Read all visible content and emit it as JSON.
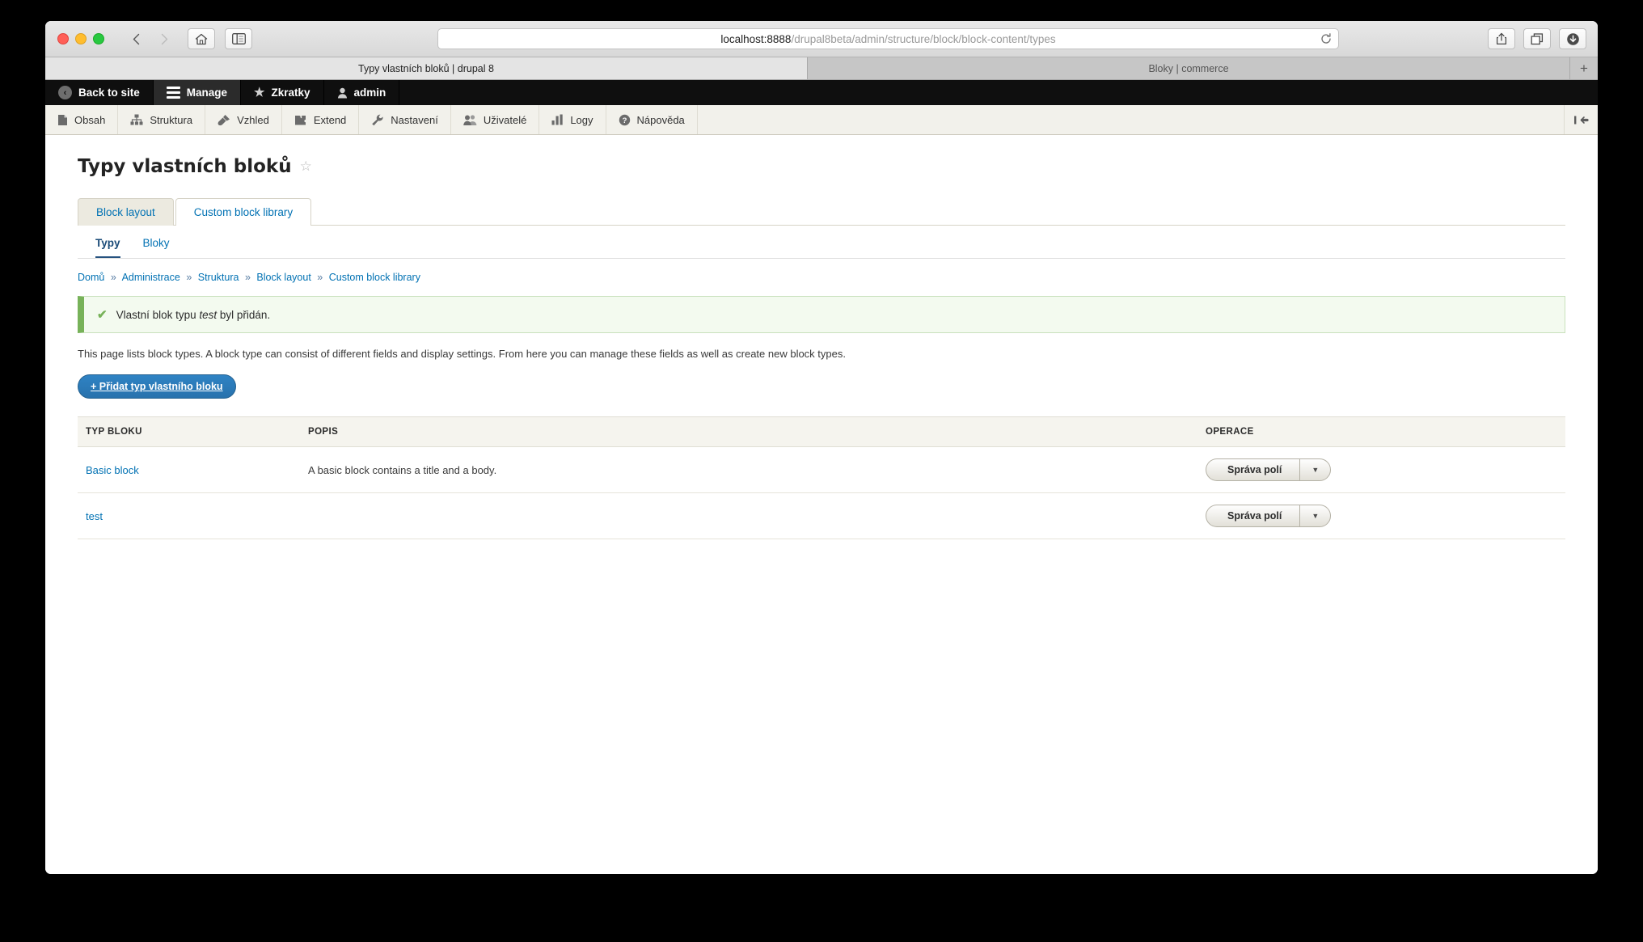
{
  "browser": {
    "url_host": "localhost:8888",
    "url_path": "/drupal8beta/admin/structure/block/block-content/types",
    "reload_icon": "reload-icon",
    "nav_back_icon": "back-chevron-icon",
    "nav_forward_icon": "forward-chevron-icon",
    "home_icon": "home-icon",
    "sidebar_icon": "sidebar-toggle-icon",
    "share_icon": "share-icon",
    "tabs_overview_icon": "tabs-overview-icon",
    "downloads_icon": "downloads-icon",
    "tabs": [
      {
        "label": "Typy vlastních bloků | drupal 8",
        "active": true
      },
      {
        "label": "Bloky | commerce",
        "active": false
      }
    ],
    "new_tab_label": "+"
  },
  "admin_toolbar": {
    "back_to_site": "Back to site",
    "manage": "Manage",
    "shortcuts": "Zkratky",
    "account": "admin"
  },
  "admin_menu": {
    "items": [
      {
        "label": "Obsah",
        "icon": "content-file-icon"
      },
      {
        "label": "Struktura",
        "icon": "structure-hierarchy-icon"
      },
      {
        "label": "Vzhled",
        "icon": "appearance-brush-icon"
      },
      {
        "label": "Extend",
        "icon": "extend-puzzle-icon"
      },
      {
        "label": "Nastavení",
        "icon": "settings-wrench-icon"
      },
      {
        "label": "Uživatelé",
        "icon": "users-people-icon"
      },
      {
        "label": "Logy",
        "icon": "reports-bars-icon"
      },
      {
        "label": "Nápověda",
        "icon": "help-question-icon"
      }
    ],
    "collapse_icon": "collapse-tray-icon"
  },
  "page": {
    "title": "Typy vlastních bloků",
    "favorite_icon": "star-outline-icon",
    "primary_tabs": [
      {
        "label": "Block layout",
        "active": false
      },
      {
        "label": "Custom block library",
        "active": true
      }
    ],
    "secondary_tabs": [
      {
        "label": "Typy",
        "active": true
      },
      {
        "label": "Bloky",
        "active": false
      }
    ],
    "breadcrumb": [
      "Domů",
      "Administrace",
      "Struktura",
      "Block layout",
      "Custom block library"
    ],
    "breadcrumb_separator": "»",
    "status_message": {
      "icon": "check-icon",
      "prefix": "Vlastní blok typu ",
      "emphasis": "test",
      "suffix": " byl přidán."
    },
    "intro_text": "This page lists block types. A block type can consist of different fields and display settings. From here you can manage these fields as well as create new block types.",
    "add_button_label": "+ Přidat typ vlastního bloku",
    "table": {
      "headers": [
        "TYP BLOKU",
        "POPIS",
        "OPERACE"
      ],
      "rows": [
        {
          "type": "Basic block",
          "description": "A basic block contains a title and a body.",
          "operation": "Správa polí",
          "operation_toggle": "▼"
        },
        {
          "type": "test",
          "description": "",
          "operation": "Správa polí",
          "operation_toggle": "▼"
        }
      ]
    }
  },
  "colors": {
    "accent_blue": "#0071b3",
    "button_blue": "#2872ad",
    "status_green": "#77b259",
    "toolbar_black": "#0f0f0f"
  }
}
